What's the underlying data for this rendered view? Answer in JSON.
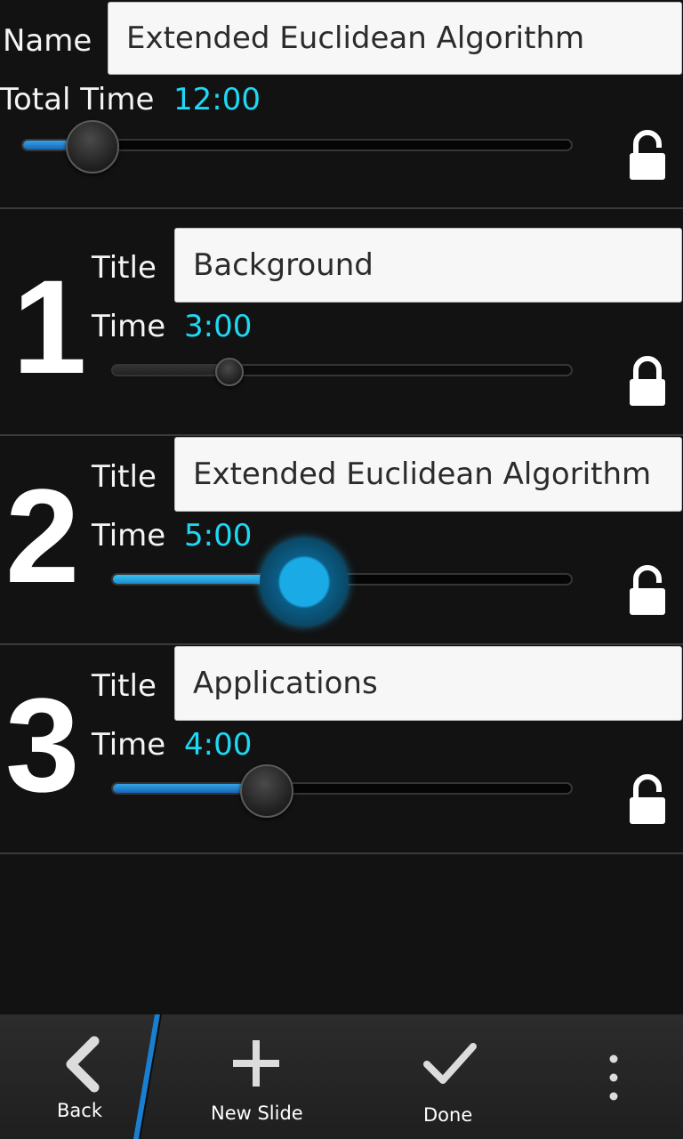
{
  "header": {
    "name_label": "Name",
    "name_value": "Extended Euclidean Algorithm",
    "total_time_label": "Total Time",
    "total_time_value": "12:00",
    "total_slider_fraction": 0.13,
    "lock_state": "unlocked"
  },
  "slides": [
    {
      "number": "1",
      "title_label": "Title",
      "title_value": "Background",
      "time_label": "Time",
      "time_value": "3:00",
      "slider_fraction": 0.25,
      "lock_state": "locked"
    },
    {
      "number": "2",
      "title_label": "Title",
      "title_value": "Extended Euclidean Algorithm",
      "time_label": "Time",
      "time_value": "5:00",
      "slider_fraction": 0.42,
      "lock_state": "unlocked"
    },
    {
      "number": "3",
      "title_label": "Title",
      "title_value": "Applications",
      "time_label": "Time",
      "time_value": "4:00",
      "slider_fraction": 0.33,
      "lock_state": "unlocked"
    }
  ],
  "actions": {
    "back": "Back",
    "new_slide": "New Slide",
    "done": "Done"
  },
  "colors": {
    "accent": "#1ed8f4",
    "slider_fill": "#2a8fd8",
    "active_knob": "#1aaae6",
    "background": "#121212"
  }
}
